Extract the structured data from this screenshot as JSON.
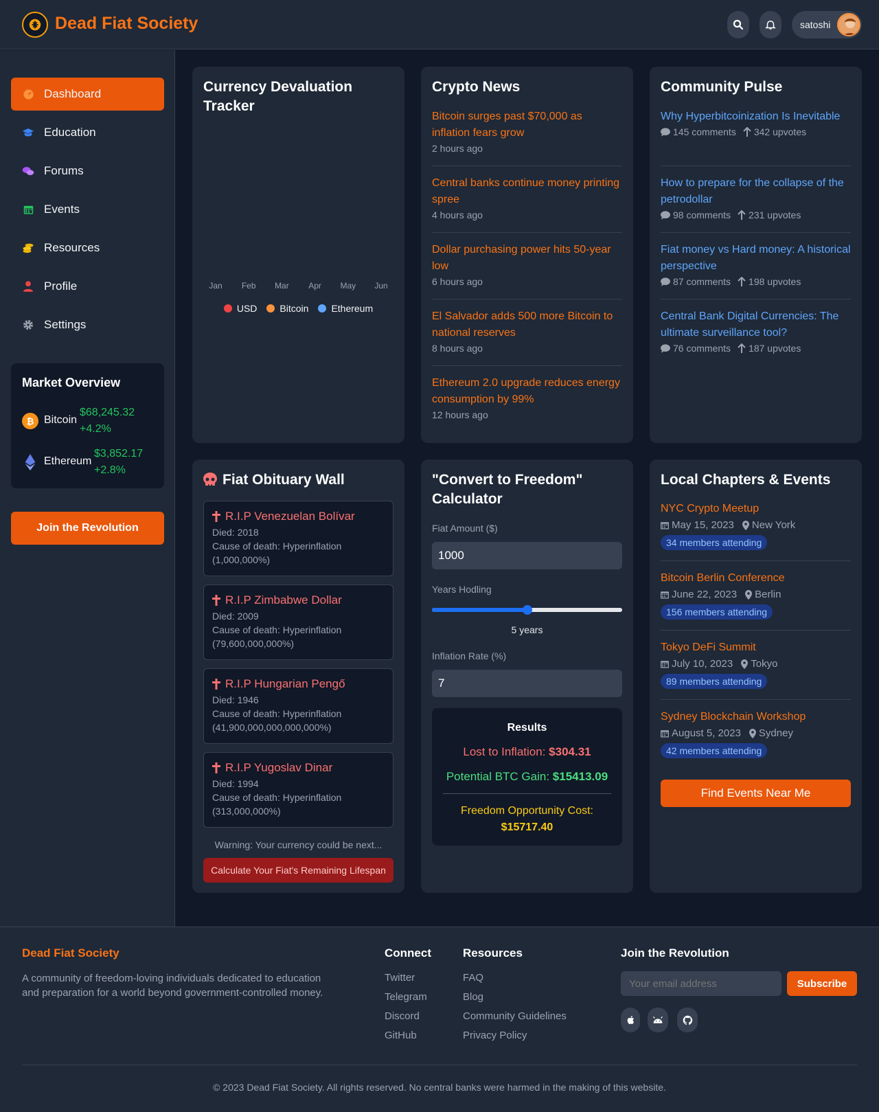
{
  "header": {
    "brand": "Dead Fiat Society",
    "username": "satoshi",
    "icons": [
      "logo-icon",
      "search-icon",
      "bell-icon",
      "avatar"
    ]
  },
  "sidebar": {
    "items": [
      {
        "label": "Dashboard",
        "icon": "dashboard-icon",
        "active": true
      },
      {
        "label": "Education",
        "icon": "graduation-cap-icon"
      },
      {
        "label": "Forums",
        "icon": "chat-bubbles-icon"
      },
      {
        "label": "Events",
        "icon": "calendar-icon"
      },
      {
        "label": "Resources",
        "icon": "coins-icon"
      },
      {
        "label": "Profile",
        "icon": "user-icon"
      },
      {
        "label": "Settings",
        "icon": "gear-icon"
      }
    ],
    "market": {
      "title": "Market Overview",
      "coins": [
        {
          "name": "Bitcoin",
          "price": "$68,245.32",
          "change": "+4.2%",
          "color": "#f7931a"
        },
        {
          "name": "Ethereum",
          "price": "$3,852.17",
          "change": "+2.8%",
          "color": "#627eea"
        }
      ]
    },
    "join_label": "Join the Revolution"
  },
  "tracker": {
    "title": "Currency Devaluation Tracker",
    "chart_data": {
      "type": "line",
      "categories": [
        "Jan",
        "Feb",
        "Mar",
        "Apr",
        "May",
        "Jun"
      ],
      "series": [
        {
          "name": "USD",
          "color": "#ef4444"
        },
        {
          "name": "Bitcoin",
          "color": "#fb923c"
        },
        {
          "name": "Ethereum",
          "color": "#60a5fa"
        }
      ],
      "legend": "bottom"
    }
  },
  "news": {
    "title": "Crypto News",
    "items": [
      {
        "title": "Bitcoin surges past $70,000 as inflation fears grow",
        "time": "2 hours ago"
      },
      {
        "title": "Central banks continue money printing spree",
        "time": "4 hours ago"
      },
      {
        "title": "Dollar purchasing power hits 50-year low",
        "time": "6 hours ago"
      },
      {
        "title": "El Salvador adds 500 more Bitcoin to national reserves",
        "time": "8 hours ago"
      },
      {
        "title": "Ethereum 2.0 upgrade reduces energy consumption by 99%",
        "time": "12 hours ago"
      }
    ]
  },
  "pulse": {
    "title": "Community Pulse",
    "items": [
      {
        "title": "Why Hyperbitcoinization Is Inevitable",
        "comments": "145 comments",
        "upvotes": "342 upvotes"
      },
      {
        "title": "How to prepare for the collapse of the petrodollar",
        "comments": "98 comments",
        "upvotes": "231 upvotes"
      },
      {
        "title": "Fiat money vs Hard money: A historical perspective",
        "comments": "87 comments",
        "upvotes": "198 upvotes"
      },
      {
        "title": "Central Bank Digital Currencies: The ultimate surveillance tool?",
        "comments": "76 comments",
        "upvotes": "187 upvotes"
      }
    ]
  },
  "obituary": {
    "title": "Fiat Obituary Wall",
    "items": [
      {
        "name": "R.I.P Venezuelan Bolívar",
        "died": "Died: 2018",
        "cause": "Cause of death: Hyperinflation (1,000,000%)"
      },
      {
        "name": "R.I.P Zimbabwe Dollar",
        "died": "Died: 2009",
        "cause": "Cause of death: Hyperinflation (79,600,000,000%)"
      },
      {
        "name": "R.I.P Hungarian Pengő",
        "died": "Died: 1946",
        "cause": "Cause of death: Hyperinflation (41,900,000,000,000,000%)"
      },
      {
        "name": "R.I.P Yugoslav Dinar",
        "died": "Died: 1994",
        "cause": "Cause of death: Hyperinflation (313,000,000%)"
      }
    ],
    "warning": "Warning: Your currency could be next...",
    "button": "Calculate Your Fiat's Remaining Lifespan"
  },
  "calculator": {
    "title": "\"Convert to Freedom\" Calculator",
    "fiat_label": "Fiat Amount ($)",
    "fiat_value": "1000",
    "years_label": "Years Hodling",
    "years_value": 5,
    "years_max": 10,
    "years_text": "5 years",
    "inflation_label": "Inflation Rate (%)",
    "inflation_value": "7",
    "results": {
      "title": "Results",
      "lost_label": "Lost to Inflation:",
      "lost_value": "$304.31",
      "gain_label": "Potential BTC Gain:",
      "gain_value": "$15413.09",
      "cost_label": "Freedom Opportunity Cost:",
      "cost_value": "$15717.40"
    }
  },
  "events": {
    "title": "Local Chapters & Events",
    "items": [
      {
        "name": "NYC Crypto Meetup",
        "date": "May 15, 2023",
        "place": "New York",
        "attending": "34 members attending"
      },
      {
        "name": "Bitcoin Berlin Conference",
        "date": "June 22, 2023",
        "place": "Berlin",
        "attending": "156 members attending"
      },
      {
        "name": "Tokyo DeFi Summit",
        "date": "July 10, 2023",
        "place": "Tokyo",
        "attending": "89 members attending"
      },
      {
        "name": "Sydney Blockchain Workshop",
        "date": "August 5, 2023",
        "place": "Sydney",
        "attending": "42 members attending"
      }
    ],
    "button": "Find Events Near Me"
  },
  "footer": {
    "brand": "Dead Fiat Society",
    "description": "A community of freedom-loving individuals dedicated to education and preparation for a world beyond government-controlled money.",
    "connect_title": "Connect",
    "connect": [
      "Twitter",
      "Telegram",
      "Discord",
      "GitHub"
    ],
    "resources_title": "Resources",
    "resources": [
      "FAQ",
      "Blog",
      "Community Guidelines",
      "Privacy Policy"
    ],
    "join_title": "Join the Revolution",
    "email_placeholder": "Your email address",
    "subscribe": "Subscribe",
    "social_icons": [
      "apple-icon",
      "android-icon",
      "github-icon"
    ],
    "copyright": "© 2023 Dead Fiat Society. All rights reserved. No central banks were harmed in the making of this website."
  }
}
